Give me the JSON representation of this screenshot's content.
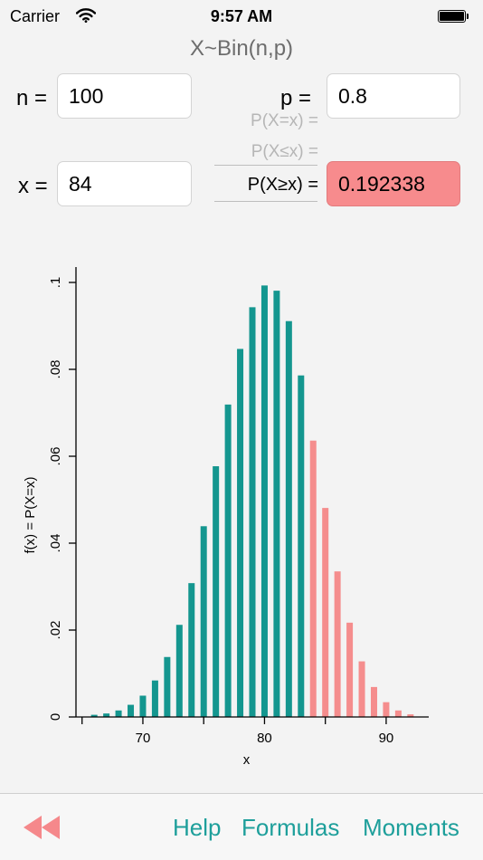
{
  "status_bar": {
    "carrier": "Carrier",
    "time": "9:57 AM",
    "wifi_icon": "wifi-icon",
    "battery_icon": "battery-full-icon"
  },
  "title": "X~Bin(n,p)",
  "inputs": {
    "n_label": "n =",
    "n_value": "100",
    "p_label": "p =",
    "p_value": "0.8",
    "x_label": "x =",
    "x_value": "84"
  },
  "result": {
    "options": [
      "P(X=x) =",
      "P(X≤x) =",
      "P(X≥x) ="
    ],
    "selected_index": 2,
    "value": "0.192338"
  },
  "colors": {
    "accent": "#1e9f9b",
    "bar_main": "#14968f",
    "bar_highlight": "#f58d8d",
    "result_bg": "#f78b8d",
    "title": "#6d6d6d"
  },
  "chart_data": {
    "type": "bar",
    "xlabel": "x",
    "ylabel": "f(x) = P(X=x)",
    "xlim": [
      64.5,
      93.5
    ],
    "ylim": [
      0,
      0.1
    ],
    "xticks": [
      70,
      80,
      90
    ],
    "xtick_labels": [
      "70",
      "80",
      "90"
    ],
    "yticks": [
      0,
      0.02,
      0.04,
      0.06,
      0.08,
      0.1
    ],
    "ytick_labels": [
      "0",
      ".02",
      ".04",
      ".06",
      ".08",
      ".1"
    ],
    "highlight_from": 84,
    "x": [
      66,
      67,
      68,
      69,
      70,
      71,
      72,
      73,
      74,
      75,
      76,
      77,
      78,
      79,
      80,
      81,
      82,
      83,
      84,
      85,
      86,
      87,
      88,
      89,
      90,
      91,
      92
    ],
    "values": [
      0.0005,
      0.0008,
      0.0015,
      0.0028,
      0.0049,
      0.0084,
      0.0138,
      0.0212,
      0.0308,
      0.0439,
      0.0577,
      0.0719,
      0.0847,
      0.0943,
      0.0993,
      0.0981,
      0.0911,
      0.0786,
      0.0636,
      0.0481,
      0.0335,
      0.0217,
      0.0128,
      0.0069,
      0.0034,
      0.0015,
      0.0006
    ]
  },
  "toolbar": {
    "back_icon": "rewind-icon",
    "help": "Help",
    "formulas": "Formulas",
    "moments": "Moments"
  }
}
